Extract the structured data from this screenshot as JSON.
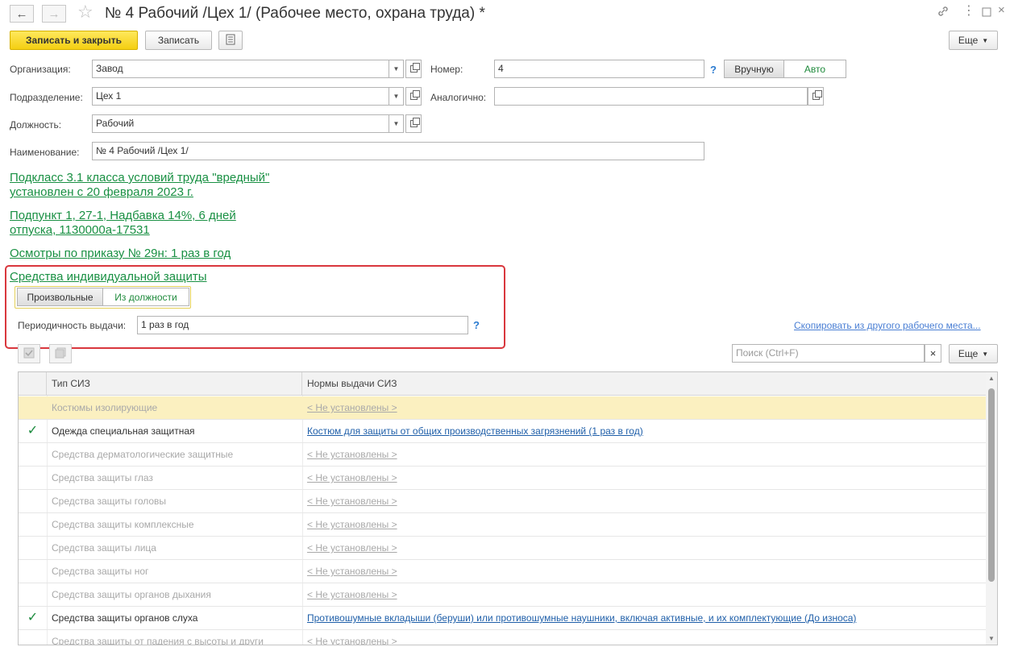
{
  "window": {
    "title": "№ 4 Рабочий /Цех 1/ (Рабочее место, охрана труда) *"
  },
  "toolbar": {
    "save_close": "Записать и закрыть",
    "save": "Записать",
    "more": "Еще"
  },
  "form": {
    "org_label": "Организация:",
    "org_value": "Завод",
    "number_label": "Номер:",
    "number_value": "4",
    "mode_manual": "Вручную",
    "mode_auto": "Авто",
    "dept_label": "Подразделение:",
    "dept_value": "Цех 1",
    "analog_label": "Аналогично:",
    "analog_value": "",
    "position_label": "Должность:",
    "position_value": "Рабочий",
    "name_label": "Наименование:",
    "name_value": "№ 4 Рабочий /Цех 1/"
  },
  "links": {
    "class_line1": "Подкласс 3.1 класса условий труда \"вредный\"",
    "class_line2": "установлен с 20 февраля 2023 г.",
    "subpoint_line1": "Подпункт 1, 27-1, Надбавка 14%, 6 дней",
    "subpoint_line2": "отпуска, 1130000а-17531",
    "exams": "Осмотры по приказу № 29н: 1 раз в год",
    "ppe": "Средства индивидуальной защиты"
  },
  "ppe": {
    "mode_custom": "Произвольные",
    "mode_from_position": "Из должности",
    "periodicity_label": "Периодичность выдачи:",
    "periodicity_value": "1 раз в год",
    "copy_link": "Скопировать из другого рабочего места..."
  },
  "table_toolbar": {
    "search_placeholder": "Поиск (Ctrl+F)",
    "clear": "×",
    "more": "Еще"
  },
  "table": {
    "headers": [
      "Тип СИЗ",
      "Нормы выдачи СИЗ"
    ],
    "rows": [
      {
        "checked": "",
        "type": "Костюмы изолирующие",
        "norm": "< Не установлены >",
        "state": "selected"
      },
      {
        "checked": "✓",
        "type": "Одежда специальная защитная",
        "norm": "Костюм для защиты от общих производственных загрязнений (1 раз в год)",
        "state": "set"
      },
      {
        "checked": "",
        "type": "Средства дерматологические защитные",
        "norm": "< Не установлены >",
        "state": "unset"
      },
      {
        "checked": "",
        "type": "Средства защиты глаз",
        "norm": "< Не установлены >",
        "state": "unset"
      },
      {
        "checked": "",
        "type": "Средства защиты головы",
        "norm": "< Не установлены >",
        "state": "unset"
      },
      {
        "checked": "",
        "type": "Средства защиты комплексные",
        "norm": "< Не установлены >",
        "state": "unset"
      },
      {
        "checked": "",
        "type": "Средства защиты лица",
        "norm": "< Не установлены >",
        "state": "unset"
      },
      {
        "checked": "",
        "type": "Средства защиты ног",
        "norm": "< Не установлены >",
        "state": "unset"
      },
      {
        "checked": "",
        "type": "Средства защиты органов дыхания",
        "norm": "< Не установлены >",
        "state": "unset"
      },
      {
        "checked": "✓",
        "type": "Средства защиты органов слуха",
        "norm": "Противошумные вкладыши (беруши) или противошумные наушники, включая активные, и их комплектующие (До износа)",
        "state": "set"
      },
      {
        "checked": "",
        "type": "Средства защиты от падения с высоты и други",
        "norm": "< Не установлены >",
        "state": "unset"
      }
    ]
  },
  "colors": {
    "accent_green": "#199043",
    "primary_button": "#f4cf12",
    "highlight_border": "#d9373d",
    "selected_row": "#fbf0c0",
    "link_blue": "#1f5fa9"
  }
}
